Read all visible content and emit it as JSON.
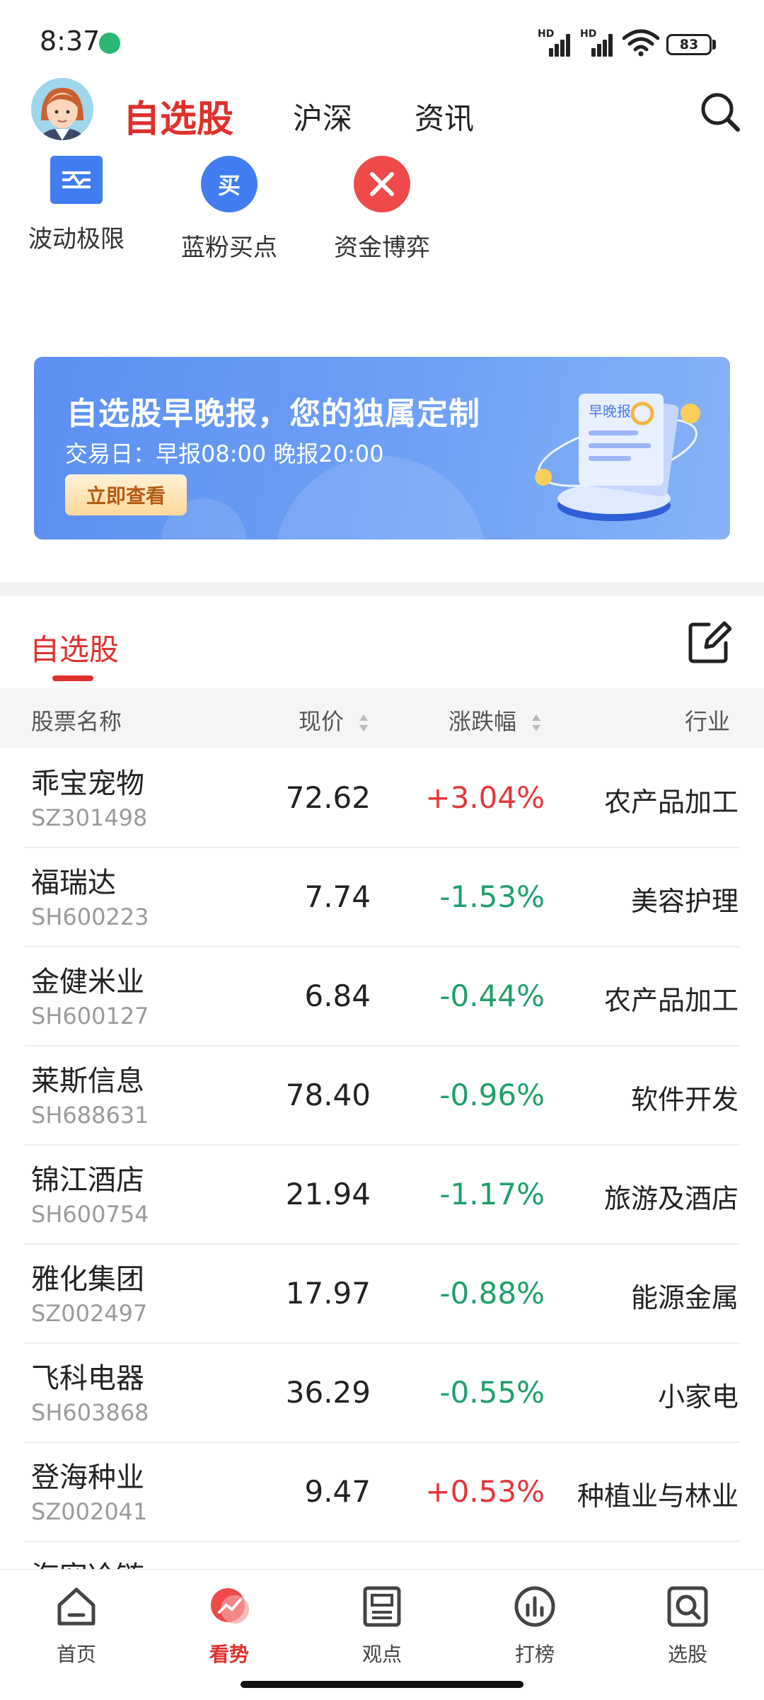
{
  "status_bar": {
    "time": "8:37",
    "network_1": "HD",
    "network_2": "HD",
    "battery": "83"
  },
  "header": {
    "tabs": [
      {
        "label": "自选股",
        "active": true
      },
      {
        "label": "沪深",
        "active": false
      },
      {
        "label": "资讯",
        "active": false
      }
    ],
    "search_icon": "search-icon"
  },
  "tools": [
    {
      "label": "波动极限",
      "icon": "wave-chart-icon",
      "color": "#3f7df0"
    },
    {
      "label": "蓝粉买点",
      "icon": "buy-icon",
      "icon_text": "买",
      "color": "#3f7df0"
    },
    {
      "label": "资金博弈",
      "icon": "swords-icon",
      "color": "#ef4a4a"
    }
  ],
  "banner": {
    "title": "自选股早晚报，您的独属定制",
    "subtitle": "交易日：早报08:00 晚报20:00",
    "button": "立即查看",
    "illustration_text": "早晚报"
  },
  "watchlist": {
    "title": "自选股",
    "columns": {
      "name": "股票名称",
      "price": "现价",
      "change": "涨跌幅",
      "industry": "行业"
    },
    "up_color": "#e5363b",
    "down_color": "#1fa06c",
    "rows": [
      {
        "name": "乖宝宠物",
        "code": "SZ301498",
        "price": "72.62",
        "change": "+3.04%",
        "industry": "农产品加工",
        "direction": "up"
      },
      {
        "name": "福瑞达",
        "code": "SH600223",
        "price": "7.74",
        "change": "-1.53%",
        "industry": "美容护理",
        "direction": "down"
      },
      {
        "name": "金健米业",
        "code": "SH600127",
        "price": "6.84",
        "change": "-0.44%",
        "industry": "农产品加工",
        "direction": "down"
      },
      {
        "name": "莱斯信息",
        "code": "SH688631",
        "price": "78.40",
        "change": "-0.96%",
        "industry": "软件开发",
        "direction": "down"
      },
      {
        "name": "锦江酒店",
        "code": "SH600754",
        "price": "21.94",
        "change": "-1.17%",
        "industry": "旅游及酒店",
        "direction": "down"
      },
      {
        "name": "雅化集团",
        "code": "SZ002497",
        "price": "17.97",
        "change": "-0.88%",
        "industry": "能源金属",
        "direction": "down"
      },
      {
        "name": "飞科电器",
        "code": "SH603868",
        "price": "36.29",
        "change": "-0.55%",
        "industry": "小家电",
        "direction": "down"
      },
      {
        "name": "登海种业",
        "code": "SZ002041",
        "price": "9.47",
        "change": "+0.53%",
        "industry": "种植业与林业",
        "direction": "up"
      },
      {
        "name": "海容冷链",
        "code": "",
        "price": "",
        "change": "",
        "industry": "",
        "direction": "up"
      }
    ]
  },
  "bottom_nav": [
    {
      "label": "首页",
      "icon": "home-icon",
      "active": false
    },
    {
      "label": "看势",
      "icon": "trend-icon",
      "active": true
    },
    {
      "label": "观点",
      "icon": "document-icon",
      "active": false
    },
    {
      "label": "打榜",
      "icon": "chart-ranking-icon",
      "active": false
    },
    {
      "label": "选股",
      "icon": "stock-search-icon",
      "active": false
    }
  ]
}
